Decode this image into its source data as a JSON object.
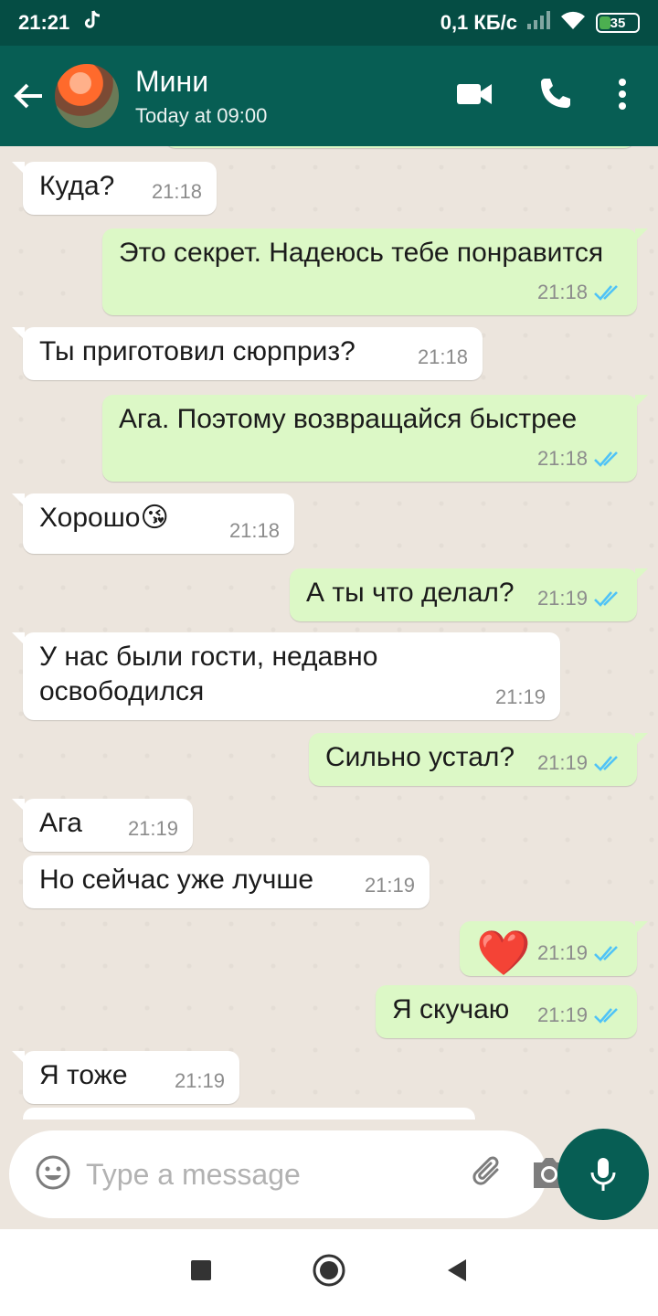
{
  "status": {
    "time": "21:21",
    "speed": "0,1 КБ/с",
    "battery": "35"
  },
  "header": {
    "contact_name": "Мини",
    "last_seen": "Today at 09:00"
  },
  "messages": [
    {
      "dir": "in",
      "text": "Куда?",
      "time": "21:18"
    },
    {
      "dir": "out",
      "text": "Это секрет. Надеюсь тебе понравится",
      "time": "21:18"
    },
    {
      "dir": "in",
      "text": "Ты приготовил сюрприз?",
      "time": "21:18"
    },
    {
      "dir": "out",
      "text": "Ага. Поэтому возвращайся быстрее",
      "time": "21:18"
    },
    {
      "dir": "in",
      "text": "Хорошо😘",
      "time": "21:18"
    },
    {
      "dir": "out",
      "text": "А ты что делал?",
      "time": "21:19"
    },
    {
      "dir": "in",
      "text": "У нас были гости, недавно освободился",
      "time": "21:19"
    },
    {
      "dir": "out",
      "text": "Сильно устал?",
      "time": "21:19"
    },
    {
      "dir": "in",
      "text": "Ага",
      "time": "21:19"
    },
    {
      "dir": "in",
      "text": "Но сейчас уже лучше",
      "time": "21:19"
    },
    {
      "dir": "out",
      "text": "❤️",
      "time": "21:19"
    },
    {
      "dir": "out",
      "text": "Я скучаю",
      "time": "21:19"
    },
    {
      "dir": "in",
      "text": "Я тоже",
      "time": "21:19"
    }
  ],
  "composer": {
    "placeholder": "Type a message"
  },
  "colors": {
    "header": "#075e54",
    "statusbar": "#054d44",
    "outgoing_bubble": "#dcf8c6",
    "incoming_bubble": "#ffffff",
    "read_ticks": "#4fc3f7"
  }
}
